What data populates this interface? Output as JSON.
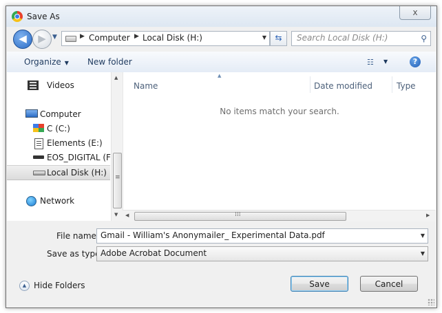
{
  "window": {
    "title": "Save As",
    "close_label": "x"
  },
  "nav": {
    "back_icon": "back-arrow-icon",
    "forward_icon": "forward-arrow-icon",
    "back_glyph": "◀",
    "forward_glyph": "▶"
  },
  "address": {
    "crumbs": [
      "Computer",
      "Local Disk (H:)"
    ],
    "separator": "▶",
    "dropdown": "▼",
    "refresh": "⇆"
  },
  "search": {
    "placeholder": "Search Local Disk (H:)",
    "value": "",
    "icon_glyph": "⚲"
  },
  "toolbar": {
    "organize_label": "Organize",
    "organize_caret": "▼",
    "new_folder_label": "New folder",
    "view_glyph": "☷",
    "view_caret": "▼",
    "help_glyph": "?"
  },
  "sidebar": {
    "items": [
      {
        "label": "Videos",
        "icon": "video-library-icon"
      },
      {
        "label": "Computer",
        "icon": "computer-icon"
      },
      {
        "label": "C (C:)",
        "icon": "drive-c-icon"
      },
      {
        "label": "Elements (E:)",
        "icon": "document-drive-icon"
      },
      {
        "label": "EOS_DIGITAL (F:)",
        "icon": "removable-drive-icon"
      },
      {
        "label": "Local Disk (H:)",
        "icon": "hard-drive-icon",
        "selected": true
      },
      {
        "label": "Network",
        "icon": "network-icon"
      }
    ]
  },
  "columns": {
    "headers": [
      "Name",
      "Date modified",
      "Type"
    ],
    "sort_caret": "▲"
  },
  "content": {
    "empty_message": "No items match your search."
  },
  "scroll": {
    "up": "▲",
    "down": "▼",
    "left": "◀",
    "right": "▶",
    "v_grip": "≡",
    "h_grip": "⁞⁞⁞"
  },
  "form": {
    "file_name_label": "File name:",
    "file_name_value": "Gmail - William's Anonymailer_ Experimental Data.pdf",
    "save_type_label": "Save as type:",
    "save_type_value": "Adobe Acrobat Document",
    "dropdown": "▼"
  },
  "footer": {
    "hide_folders_label": "Hide Folders",
    "hide_folders_glyph": "▲",
    "save_label": "Save",
    "cancel_label": "Cancel"
  }
}
